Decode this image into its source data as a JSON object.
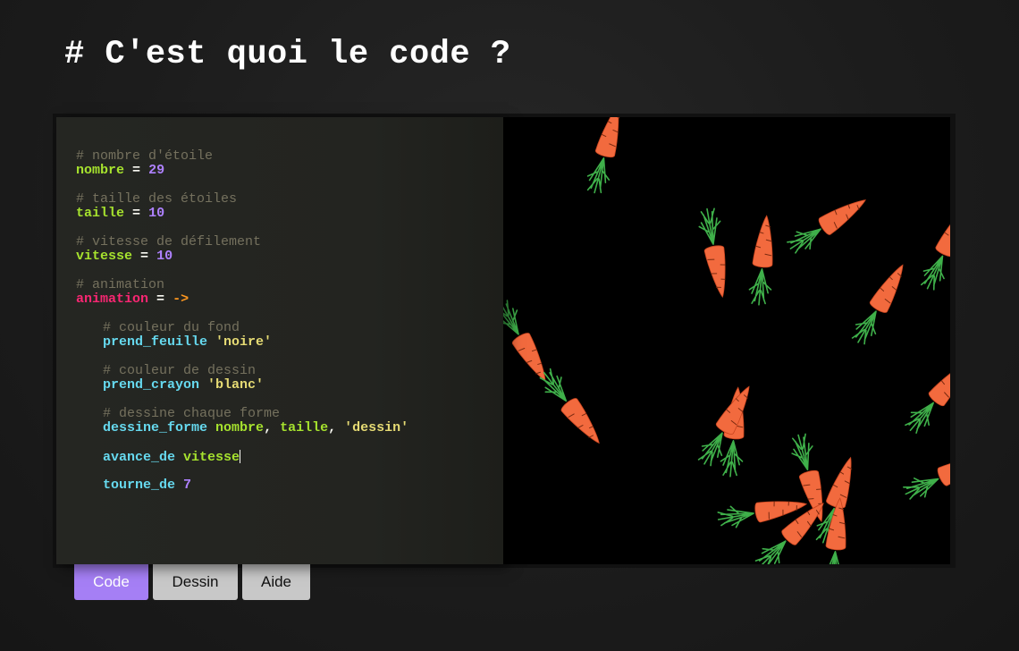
{
  "page": {
    "title": "# C'est quoi le code ?"
  },
  "editor": {
    "lines": {
      "c1": "# nombre d'étoile",
      "v1": "nombre",
      "n1": "29",
      "c2": "# taille des étoiles",
      "v2": "taille",
      "n2": "10",
      "c3": "# vitesse de défilement",
      "v3": "vitesse",
      "n3": "10",
      "c4": "# animation",
      "v4": "animation",
      "arrow": "->",
      "c5": "# couleur du fond",
      "f5": "prend_feuille",
      "s5": "'noire'",
      "c6": "# couleur de dessin",
      "f6": "prend_crayon",
      "s6": "'blanc'",
      "c7": "# dessine chaque forme",
      "f7": "dessine_forme",
      "a7": "nombre",
      "b7": "taille",
      "s7": "'dessin'",
      "f8": "avance_de",
      "a8": "vitesse",
      "f9": "tourne_de",
      "n9": "7",
      "eq": "=",
      "comma": ","
    }
  },
  "canvas": {
    "background": "#000000",
    "sprite": "carrot-icon",
    "carrot_color": "#f26a3e",
    "leaf_color": "#3fb04a"
  },
  "tabs": {
    "code": "Code",
    "dessin": "Dessin",
    "aide": "Aide"
  },
  "colors": {
    "accent": "#a57ff5",
    "background": "#1b1b1b"
  }
}
